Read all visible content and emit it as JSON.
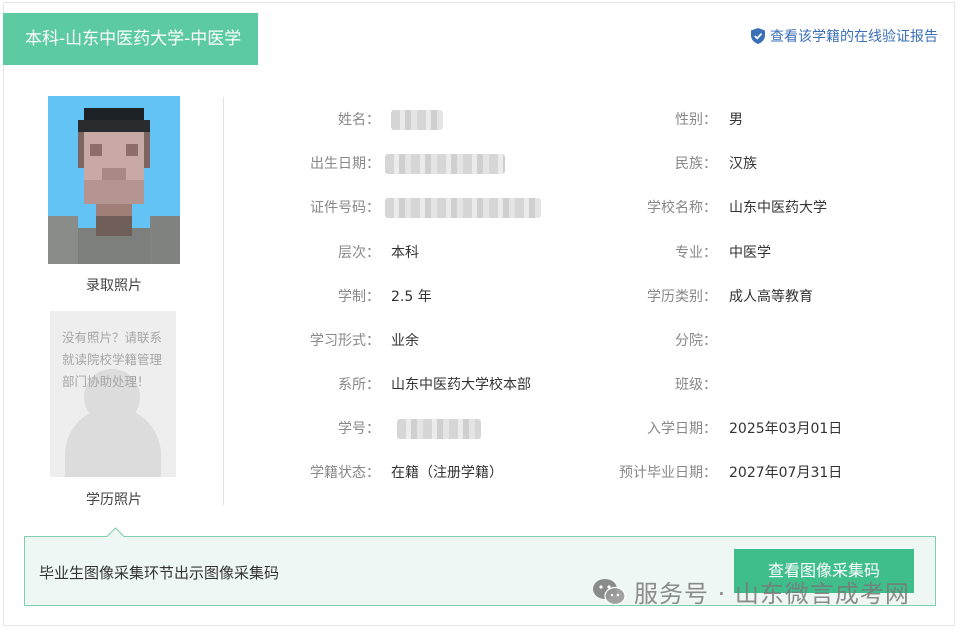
{
  "tab": {
    "title": "本科-山东中医药大学-中医学"
  },
  "verify_link": {
    "label": "查看该学籍的在线验证报告",
    "icon": "shield-check-icon"
  },
  "photos": {
    "admission_caption": "录取照片",
    "degree_caption": "学历照片",
    "no_photo_message": "没有照片？请联系就读院校学籍管理部门协助处理！"
  },
  "fields": {
    "name": {
      "label": "姓名：",
      "value": ""
    },
    "gender": {
      "label": "性别：",
      "value": "男"
    },
    "birth_date": {
      "label": "出生日期：",
      "value": ""
    },
    "ethnicity": {
      "label": "民族：",
      "value": "汉族"
    },
    "id_number": {
      "label": "证件号码：",
      "value": ""
    },
    "school": {
      "label": "学校名称：",
      "value": "山东中医药大学"
    },
    "level": {
      "label": "层次：",
      "value": "本科"
    },
    "major": {
      "label": "专业：",
      "value": "中医学"
    },
    "duration": {
      "label": "学制：",
      "value": "2.5 年"
    },
    "education_type": {
      "label": "学历类别：",
      "value": "成人高等教育"
    },
    "study_form": {
      "label": "学习形式：",
      "value": "业余"
    },
    "branch": {
      "label": "分院：",
      "value": ""
    },
    "department": {
      "label": "系所：",
      "value": "山东中医药大学校本部"
    },
    "class": {
      "label": "班级：",
      "value": ""
    },
    "student_id": {
      "label": "学号：",
      "value": ""
    },
    "enroll_date": {
      "label": "入学日期：",
      "value": "2025年03月01日"
    },
    "status": {
      "label": "学籍状态：",
      "value": "在籍（注册学籍）"
    },
    "graduation_date": {
      "label": "预计毕业日期：",
      "value": "2027年07月31日"
    }
  },
  "bottom": {
    "text": "毕业生图像采集环节出示图像采集码",
    "button_label": "查看图像采集码"
  },
  "watermark": {
    "text": "服务号 · 山东微言成考网",
    "icon": "wechat-icon"
  },
  "colors": {
    "accent": "#5ccba2",
    "button": "#3fbe8c",
    "link": "#3b6fb8",
    "photo_bg": "#63c3f5"
  }
}
